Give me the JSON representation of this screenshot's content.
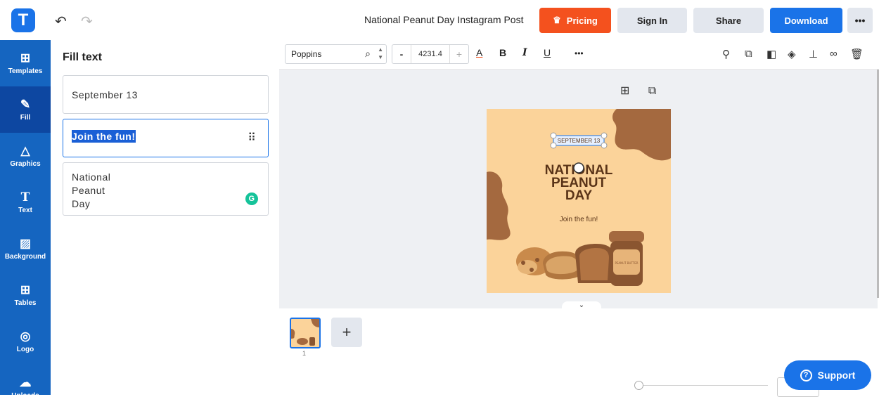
{
  "app": {
    "logo_letter": "T",
    "doc_title": "National Peanut Day Instagram Post"
  },
  "header": {
    "undo_icon": "undo-icon",
    "redo_icon": "redo-icon",
    "pricing_label": "Pricing",
    "signin_label": "Sign In",
    "share_label": "Share",
    "download_label": "Download",
    "more_label": "•••"
  },
  "sidebar": {
    "items": [
      {
        "label": "Templates",
        "icon": "templates-icon",
        "glyph": "⊞"
      },
      {
        "label": "Fill",
        "icon": "pencil-icon",
        "glyph": "✎"
      },
      {
        "label": "Graphics",
        "icon": "shapes-icon",
        "glyph": "△"
      },
      {
        "label": "Text",
        "icon": "text-icon",
        "glyph": "T"
      },
      {
        "label": "Background",
        "icon": "background-icon",
        "glyph": "▨"
      },
      {
        "label": "Tables",
        "icon": "table-icon",
        "glyph": "⊞"
      },
      {
        "label": "Logo",
        "icon": "logo-icon",
        "glyph": "◎"
      },
      {
        "label": "Uploads",
        "icon": "upload-icon",
        "glyph": "☁"
      }
    ]
  },
  "panel": {
    "title": "Fill text",
    "fields": [
      {
        "value": "September 13"
      },
      {
        "value": "Join the fun!"
      },
      {
        "line1": "National",
        "line2": "Peanut",
        "line3": "Day"
      }
    ],
    "grammarly_badge": "G"
  },
  "toolbar": {
    "font_name": "Poppins",
    "font_size": "4231.4",
    "minus": "-",
    "plus": "+",
    "bold": "B",
    "italic": "I",
    "underline": "U",
    "color_letter": "A",
    "more": "•••"
  },
  "artboard": {
    "date_text": "SEPTEMBER 13",
    "title_line1": "NATIONAL",
    "title_line2": "PEANUT",
    "title_line3": "DAY",
    "tagline": "Join the fun!",
    "jar_label": "PEANUT BUTTER",
    "colors": {
      "background": "#fbd39a",
      "blob": "#a4693f",
      "title": "#5a3418"
    }
  },
  "pages": {
    "page_number": "1",
    "add_label": "+"
  },
  "support": {
    "label": "Support"
  }
}
